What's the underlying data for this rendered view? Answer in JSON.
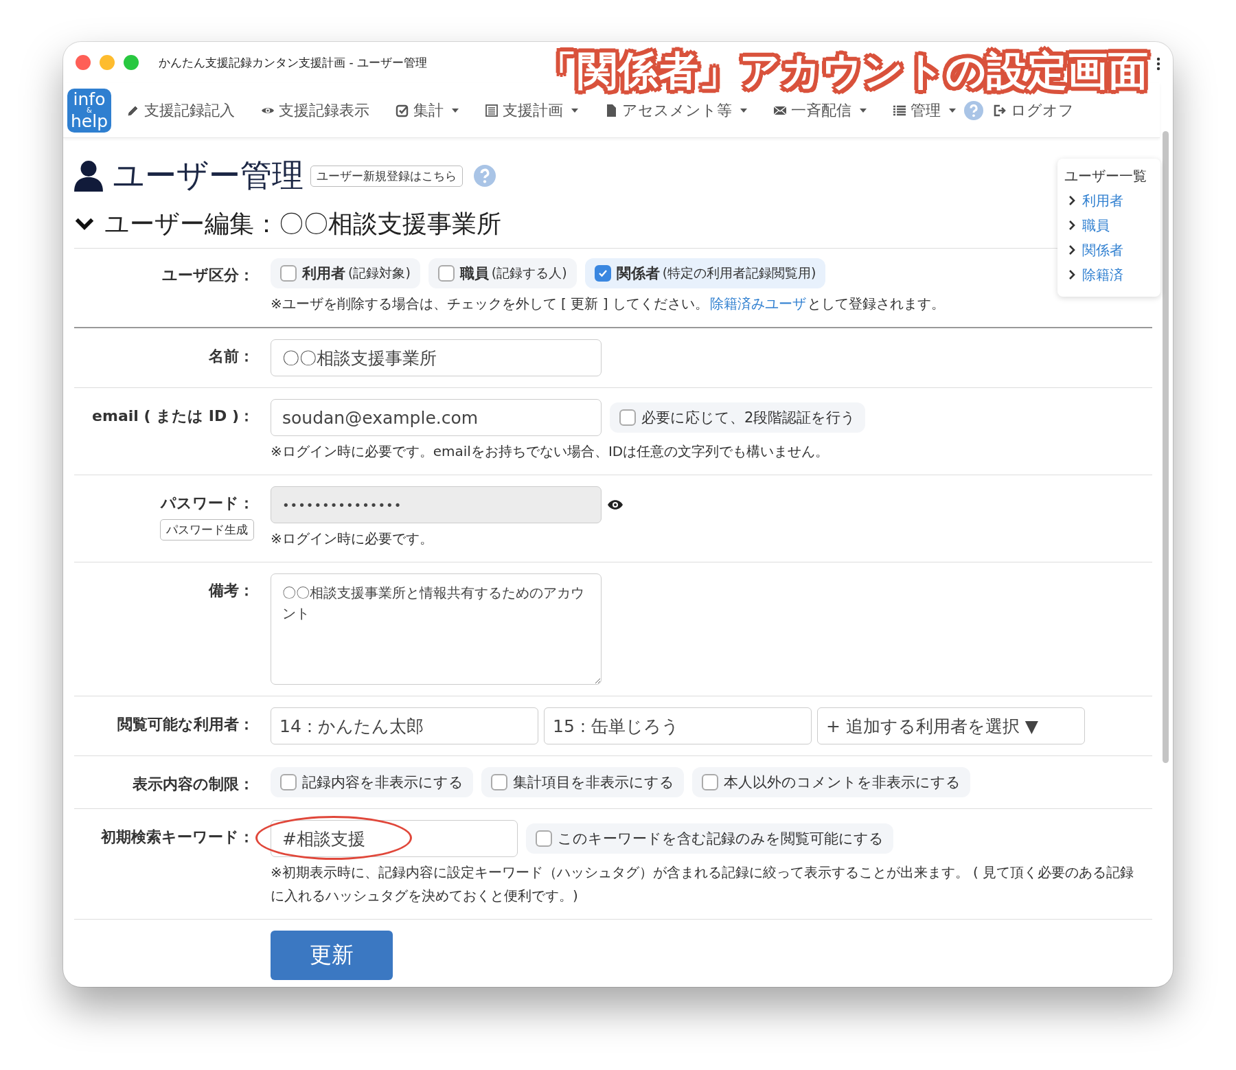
{
  "window": {
    "title": "かんたん支援記録カンタン支援計画 - ユーザー管理"
  },
  "annotation": "「関係者」アカウントの設定画面",
  "logo": [
    "info",
    "&",
    "help"
  ],
  "nav": [
    {
      "label": "支援記録記入",
      "kind": "pencil",
      "dropdown": false
    },
    {
      "label": "支援記録表示",
      "kind": "eye",
      "dropdown": false
    },
    {
      "label": "集計",
      "kind": "check",
      "dropdown": true
    },
    {
      "label": "支援計画",
      "kind": "listdoc",
      "dropdown": true
    },
    {
      "label": "アセスメント等",
      "kind": "file",
      "dropdown": true
    },
    {
      "label": "一斉配信",
      "kind": "envelope",
      "dropdown": true
    },
    {
      "label": "管理",
      "kind": "list",
      "dropdown": true
    },
    {
      "label": "ログオフ",
      "kind": "logout",
      "dropdown": false
    }
  ],
  "page": {
    "title": "ユーザー管理",
    "new_user_button": "ユーザー新規登録はこちら"
  },
  "section": {
    "title": "ユーザー編集：〇〇相談支援事業所",
    "expanded": true
  },
  "side_menu": {
    "title": "ユーザー一覧",
    "items": [
      "利用者",
      "職員",
      "関係者",
      "除籍済"
    ]
  },
  "rows": [
    {
      "kind": "checkgroup",
      "label": "ユーザ区分：",
      "options": [
        {
          "label": "利用者",
          "sub": "(記録対象)",
          "checked": false
        },
        {
          "label": "職員",
          "sub": "(記録する人)",
          "checked": false
        },
        {
          "label": "関係者",
          "sub": "(特定の利用者記録閲覧用)",
          "checked": true
        }
      ],
      "note": "※ユーザを削除する場合は、チェックを外して [ 更新 ] してください。",
      "note_link": "除籍済みユーザ",
      "note_tail": "として登録されます。"
    },
    {
      "kind": "text",
      "label": "名前：",
      "value": "〇〇相談支援事業所"
    },
    {
      "kind": "text",
      "label": "email ( または ID )：",
      "value": "soudan@example.com",
      "option": {
        "label": "必要に応じて、2段階認証を行う",
        "checked": false
      },
      "note": "※ログイン時に必要です。emailをお持ちでない場合、IDは任意の文字列でも構いません。"
    },
    {
      "kind": "password",
      "label": "パスワード：",
      "button": "パスワード生成",
      "value": "•••••••••••••••",
      "note": "※ログイン時に必要です。"
    },
    {
      "kind": "textarea",
      "label": "備考：",
      "value": "〇〇相談支援事業所と情報共有するためのアカウント"
    },
    {
      "kind": "selects",
      "label": "閲覧可能な利用者：",
      "values": [
        "14 : かんたん太郎",
        "15 : 缶単じろう",
        "+ 追加する利用者を選択 ▼"
      ]
    },
    {
      "kind": "checks",
      "label": "表示内容の制限：",
      "options": [
        {
          "label": "記録内容を非表示にする",
          "checked": false
        },
        {
          "label": "集計項目を非表示にする",
          "checked": false
        },
        {
          "label": "本人以外のコメントを非表示にする",
          "checked": false
        }
      ]
    },
    {
      "kind": "keyword",
      "label": "初期検索キーワード：",
      "value": "#相談支援",
      "highlighted": true,
      "option": {
        "label": "このキーワードを含む記録のみを閲覧可能にする",
        "checked": false
      },
      "note": "※初期表示時に、記録内容に設定キーワード（ハッシュタグ）が含まれる記録に絞って表示することが出来ます。 ( 見て頂く必要のある記録に入れるハッシュタグを決めておくと便利です。)"
    }
  ],
  "submit": "更新"
}
